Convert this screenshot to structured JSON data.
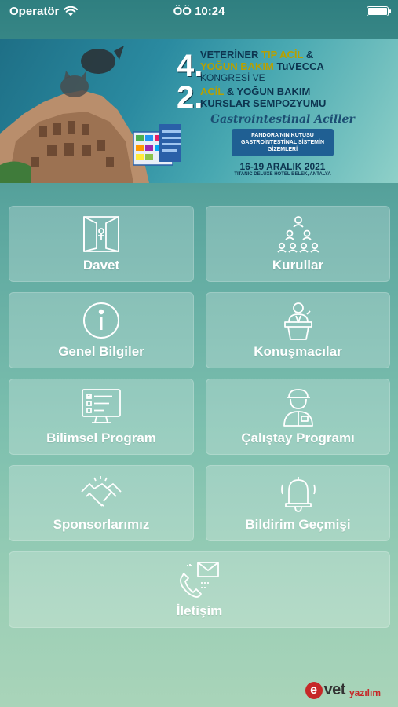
{
  "status_bar": {
    "carrier": "Operatör",
    "time": "ÖÖ 10:24"
  },
  "banner": {
    "num1": "4.",
    "line1a": "VETERİNER ",
    "line1b": "TIP ACİL",
    "line1c": " &",
    "line2a": "YOĞUN BAKIM",
    "line2b": " TuVECCA",
    "line3": "KONGRESİ VE",
    "num2": "2.",
    "line4a": "ACİL",
    "line4b": " & YOĞUN BAKIM",
    "line5": "KURSLAR SEMPOZYUMU",
    "subtitle": "Gastrointestinal Aciller",
    "badge": "PANDORA'NIN KUTUSU GASTROİNTESTİNAL SİSTEMİN GİZEMLERİ",
    "date": "16-19 ARALIK 2021",
    "hotel": "TITANIC DELUXE HOTEL BELEK, ANTALYA"
  },
  "menu": [
    {
      "label": "Davet",
      "icon": "door-icon"
    },
    {
      "label": "Kurullar",
      "icon": "org-chart-icon"
    },
    {
      "label": "Genel Bilgiler",
      "icon": "info-icon"
    },
    {
      "label": "Konuşmacılar",
      "icon": "speaker-icon"
    },
    {
      "label": "Bilimsel Program",
      "icon": "monitor-checklist-icon"
    },
    {
      "label": "Çalıştay Programı",
      "icon": "worker-icon"
    },
    {
      "label": "Sponsorlarımız",
      "icon": "handshake-icon"
    },
    {
      "label": "Bildirim Geçmişi",
      "icon": "bell-icon"
    },
    {
      "label": "İletişim",
      "icon": "phone-mail-icon"
    }
  ],
  "footer": {
    "logo_letter": "e",
    "logo_word": "vet",
    "logo_sub": "yazılım"
  }
}
